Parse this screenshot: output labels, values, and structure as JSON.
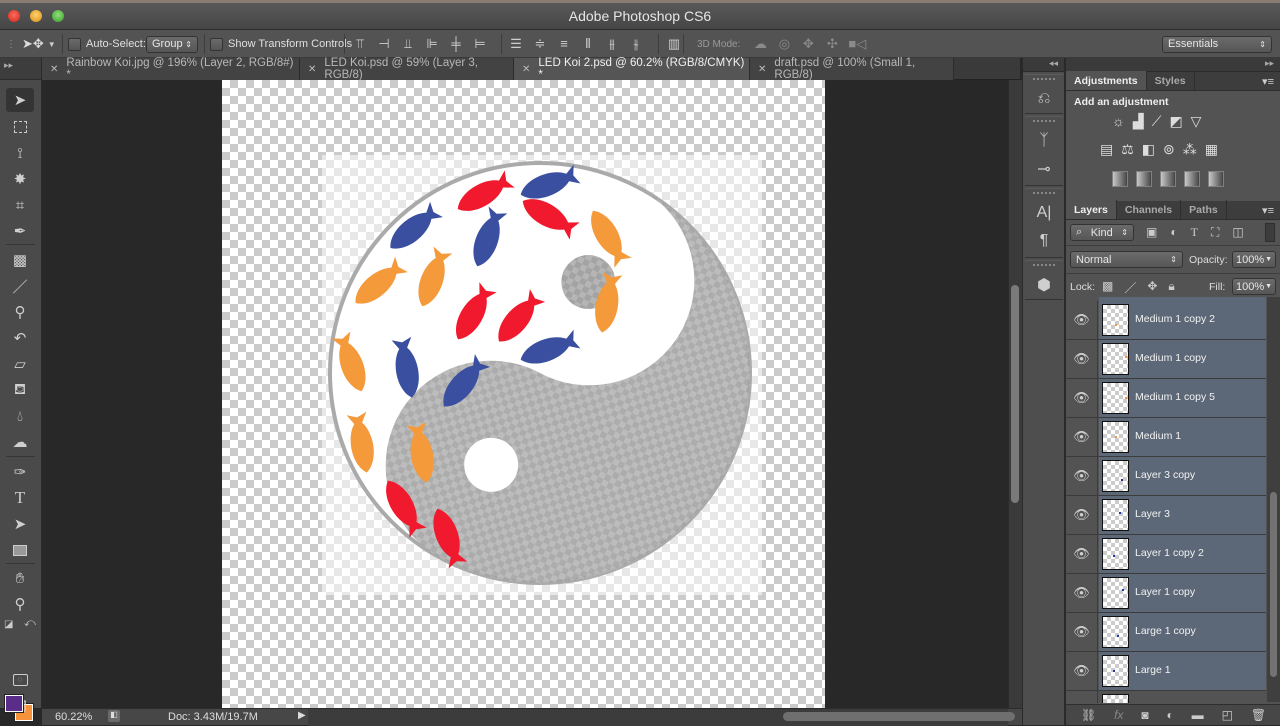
{
  "window": {
    "title": "Adobe Photoshop CS6"
  },
  "options_bar": {
    "tool_icon": "move-tool-icon",
    "auto_select_label": "Auto-Select:",
    "auto_select_checked": false,
    "auto_select_mode": "Group",
    "show_transform_label": "Show Transform Controls",
    "show_transform_checked": false,
    "align_icons": [
      "align-top-edges-icon",
      "align-vertical-centers-icon",
      "align-bottom-edges-icon",
      "align-left-edges-icon",
      "align-horizontal-centers-icon",
      "align-right-edges-icon"
    ],
    "distribute_icons": [
      "distribute-top-icon",
      "distribute-vcenter-icon",
      "distribute-bottom-icon",
      "distribute-left-icon",
      "distribute-hcenter-icon",
      "distribute-right-icon"
    ],
    "auto_align_icon": "auto-align-layers-icon",
    "mode_3d_label": "3D Mode:",
    "mode_3d_icons": [
      "rotate-3d-icon",
      "roll-3d-icon",
      "drag-3d-icon",
      "slide-3d-icon",
      "scale-3d-icon"
    ],
    "workspace": "Essentials"
  },
  "document_tabs": [
    {
      "label": "Rainbow Koi.jpg @ 196% (Layer 2, RGB/8#) *",
      "active": false
    },
    {
      "label": "LED Koi.psd @ 59% (Layer 3, RGB/8)",
      "active": false
    },
    {
      "label": "LED Koi 2.psd @ 60.2% (RGB/8/CMYK) *",
      "active": true
    },
    {
      "label": "draft.psd @ 100% (Small 1, RGB/8)",
      "active": false
    }
  ],
  "tools": [
    "move",
    "rectangular-marquee",
    "polygonal-lasso",
    "magic-wand",
    "crop",
    "eyedropper",
    "spot-healing",
    "brush",
    "clone-stamp",
    "history-brush",
    "eraser",
    "paint-bucket",
    "blur",
    "dodge",
    "pen",
    "type",
    "path-selection",
    "rectangle",
    "hand",
    "zoom"
  ],
  "colors": {
    "foreground": "#5b2d8a",
    "background": "#f6923a"
  },
  "status": {
    "zoom": "60.22%",
    "doc_size": "Doc: 3.43M/19.7M"
  },
  "adjustments": {
    "tabs": [
      "Adjustments",
      "Styles"
    ],
    "heading": "Add an adjustment"
  },
  "layers": {
    "tabs": [
      "Layers",
      "Channels",
      "Paths"
    ],
    "filter_kind": "Kind",
    "blend_mode": "Normal",
    "opacity_label": "Opacity:",
    "opacity": "100%",
    "lock_label": "Lock:",
    "fill_label": "Fill:",
    "fill": "100%",
    "items": [
      {
        "name": "Medium 1 copy 2",
        "visible": true,
        "selected": true,
        "dot": "#f6923a"
      },
      {
        "name": "Medium 1 copy",
        "visible": true,
        "selected": true,
        "dot": "#f6923a"
      },
      {
        "name": "Medium 1 copy 5",
        "visible": true,
        "selected": true,
        "dot": "#f6923a"
      },
      {
        "name": "Medium 1",
        "visible": true,
        "selected": true,
        "dot": "#f6923a"
      },
      {
        "name": "Layer 3 copy",
        "visible": true,
        "selected": true,
        "dot": "#2233aa"
      },
      {
        "name": "Layer 3",
        "visible": true,
        "selected": true,
        "dot": "#2233aa"
      },
      {
        "name": "Layer 1 copy 2",
        "visible": true,
        "selected": true,
        "dot": "#2233aa"
      },
      {
        "name": "Layer 1 copy",
        "visible": true,
        "selected": true,
        "dot": "#2233aa"
      },
      {
        "name": "Large 1 copy",
        "visible": true,
        "selected": true,
        "dot": "#2233aa"
      },
      {
        "name": "Large 1",
        "visible": true,
        "selected": true,
        "dot": "#2233aa"
      }
    ]
  }
}
